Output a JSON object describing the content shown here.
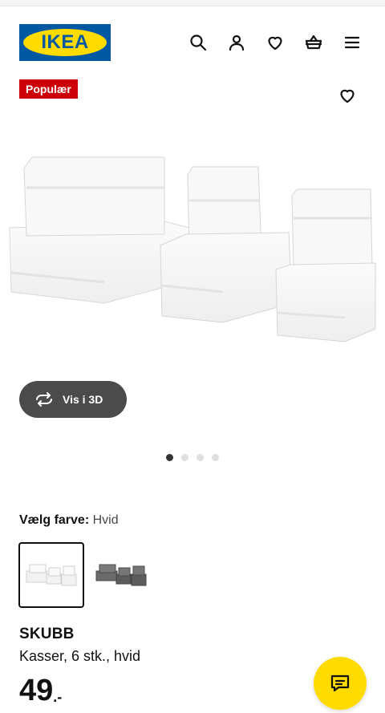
{
  "header": {
    "logo_text": "IKEA",
    "icons": [
      "search-icon",
      "account-icon",
      "heart-icon",
      "basket-icon",
      "menu-icon"
    ]
  },
  "product": {
    "badge": "Populær",
    "view_3d_label": "Vis i 3D",
    "gallery": {
      "total_images": 4,
      "active_index": 0
    },
    "colour_label": "Vælg farve:",
    "colour_value": "Hvid",
    "swatches": [
      {
        "name": "Hvid",
        "selected": true
      },
      {
        "name": "Grå",
        "selected": false
      }
    ],
    "name": "SKUBB",
    "description": "Kasser, 6 stk., hvid",
    "price_integer": "49",
    "price_decimal": ".-"
  },
  "colors": {
    "ikea_blue": "#0058a3",
    "ikea_yellow": "#ffdb00",
    "badge_red": "#cc0008",
    "dark_button": "#4b4b4b"
  }
}
